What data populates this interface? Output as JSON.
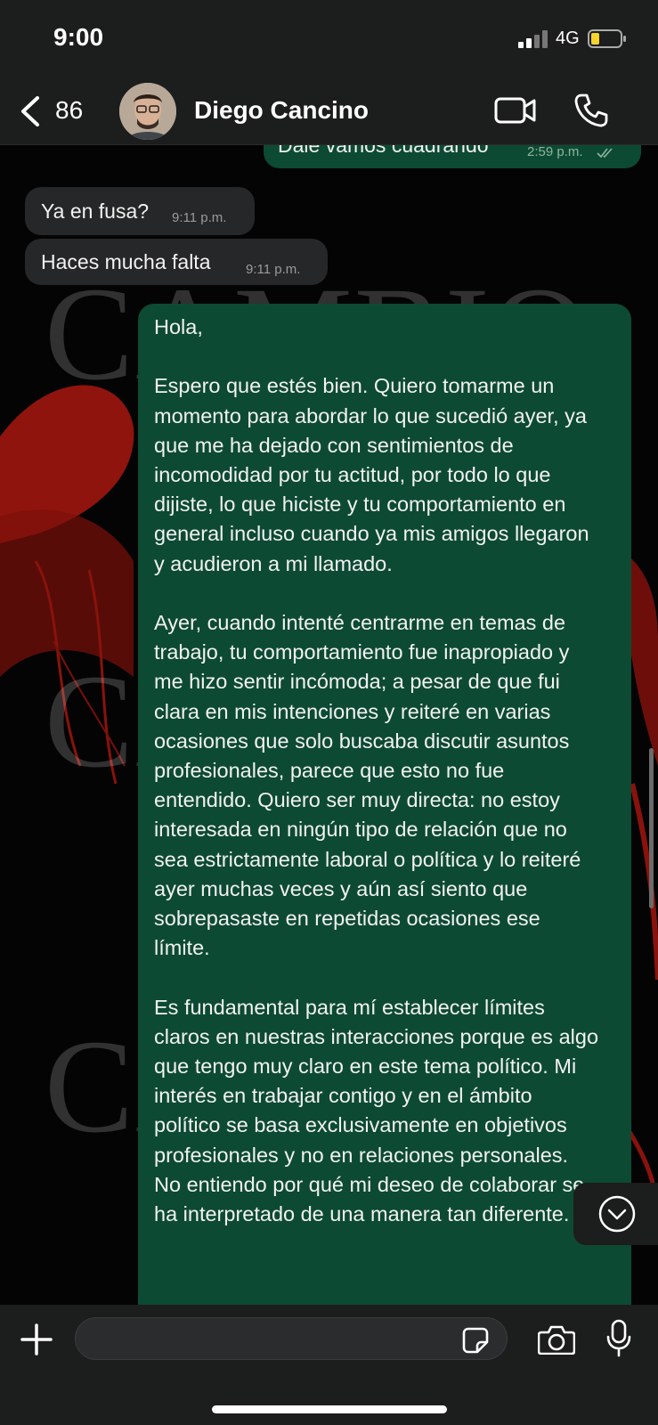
{
  "status_bar": {
    "time": "9:00",
    "network": "4G"
  },
  "header": {
    "back_count": "86",
    "contact_name": "Diego Cancino"
  },
  "messages": [
    {
      "direction": "out",
      "text": "Dale vamos cuadrando",
      "time": "2:59 p.m.",
      "read": true
    },
    {
      "direction": "in",
      "text": "Ya en fusa?",
      "time": "9:11 p.m."
    },
    {
      "direction": "in",
      "text": "Haces mucha falta",
      "time": "9:11 p.m."
    },
    {
      "direction": "out",
      "text": "Hola,\n\nEspero que estés bien. Quiero tomarme un momento para abordar lo que sucedió ayer, ya que me ha dejado con sentimientos de incomodidad por tu actitud, por todo lo que dijiste, lo que hiciste y tu comportamiento en general incluso cuando ya mis amigos llegaron y acudieron a mi llamado.\n\nAyer, cuando intenté centrarme en temas de trabajo, tu comportamiento fue inapropiado y me hizo sentir incómoda; a pesar de que fui clara en mis intenciones y reiteré en varias ocasiones que solo buscaba discutir asuntos profesionales, parece que esto no fue entendido. Quiero ser muy directa: no estoy interesada en ningún tipo de relación que no sea estrictamente laboral o política y lo reiteré ayer muchas veces y aún así siento que sobrepasaste en repetidas ocasiones ese límite.\n\nEs fundamental para mí establecer límites claros en nuestras interacciones porque es algo que tengo muy claro en este tema político. Mi interés en trabajar contigo y en el ámbito político se basa exclusivamente en objetivos profesionales y no en relaciones personales. No entiendo por qué mi deseo de colaborar se ha interpretado de una manera tan diferente."
    }
  ],
  "watermark": "CAMBIO",
  "composer": {
    "placeholder": ""
  },
  "colors": {
    "incoming_bubble": "#262728",
    "outgoing_bubble": "#0d4a33",
    "bar_background": "#1c1d1d",
    "battery_fill": "#f6d32d"
  }
}
